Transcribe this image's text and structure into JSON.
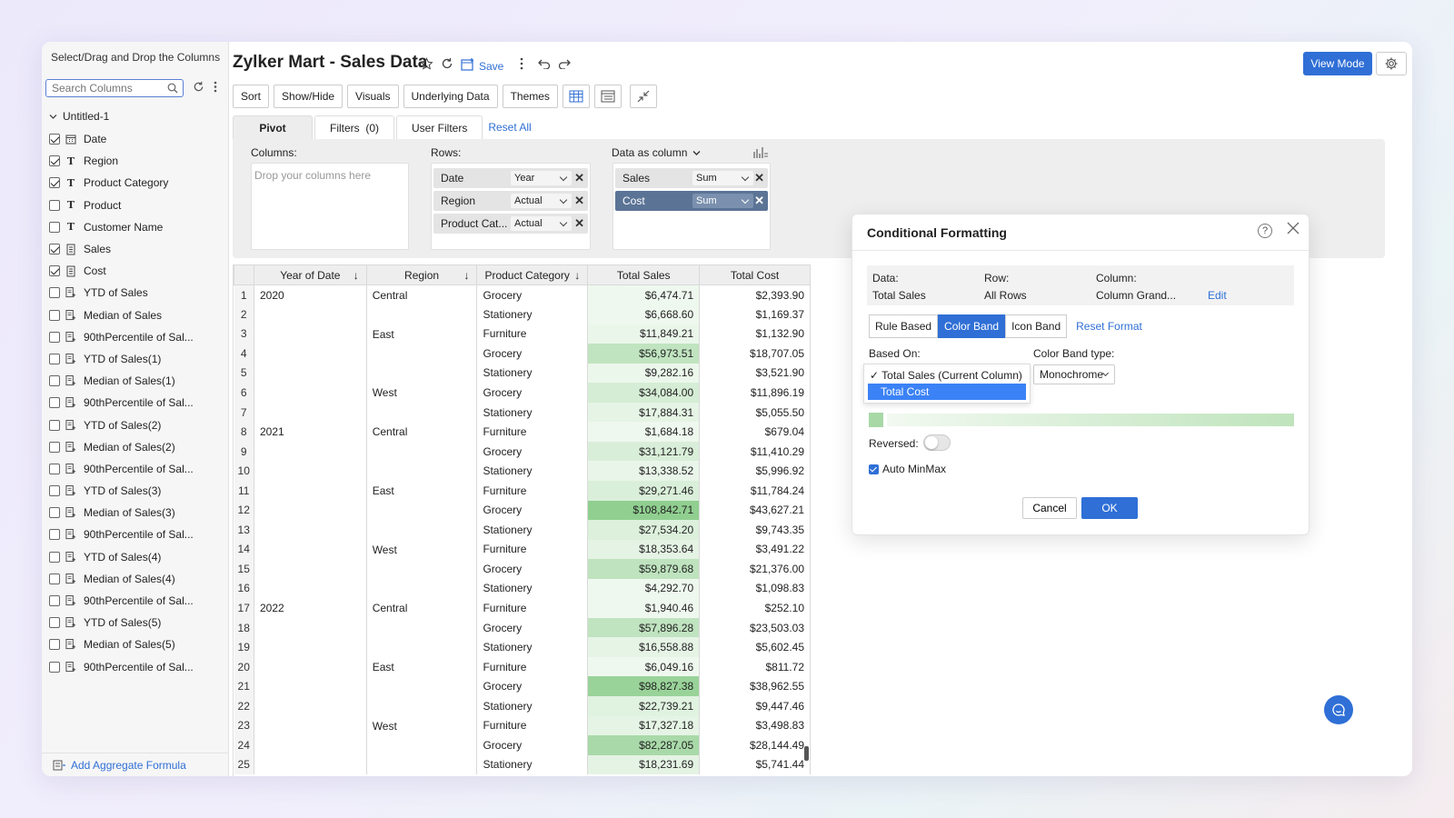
{
  "sidebar": {
    "title": "Select/Drag and Drop the Columns",
    "search_placeholder": "Search Columns",
    "root": "Untitled-1",
    "columns": [
      {
        "label": "Date",
        "checked": true,
        "icon": "calendar-icon"
      },
      {
        "label": "Region",
        "checked": true,
        "icon": "text-type-icon"
      },
      {
        "label": "Product Category",
        "checked": true,
        "icon": "text-type-icon"
      },
      {
        "label": "Product",
        "checked": false,
        "icon": "text-type-icon"
      },
      {
        "label": "Customer Name",
        "checked": false,
        "icon": "text-type-icon"
      },
      {
        "label": "Sales",
        "checked": true,
        "icon": "numeric-icon"
      },
      {
        "label": "Cost",
        "checked": true,
        "icon": "numeric-icon"
      },
      {
        "label": "YTD of Sales",
        "checked": false,
        "icon": "formula-icon"
      },
      {
        "label": "Median of Sales",
        "checked": false,
        "icon": "formula-icon"
      },
      {
        "label": "90thPercentile of Sal...",
        "checked": false,
        "icon": "formula-icon"
      },
      {
        "label": "YTD of Sales(1)",
        "checked": false,
        "icon": "formula-icon"
      },
      {
        "label": "Median of Sales(1)",
        "checked": false,
        "icon": "formula-icon"
      },
      {
        "label": "90thPercentile of Sal...",
        "checked": false,
        "icon": "formula-icon"
      },
      {
        "label": "YTD of Sales(2)",
        "checked": false,
        "icon": "formula-icon"
      },
      {
        "label": "Median of Sales(2)",
        "checked": false,
        "icon": "formula-icon"
      },
      {
        "label": "90thPercentile of Sal...",
        "checked": false,
        "icon": "formula-icon"
      },
      {
        "label": "YTD of Sales(3)",
        "checked": false,
        "icon": "formula-icon"
      },
      {
        "label": "Median of Sales(3)",
        "checked": false,
        "icon": "formula-icon"
      },
      {
        "label": "90thPercentile of Sal...",
        "checked": false,
        "icon": "formula-icon"
      },
      {
        "label": "YTD of Sales(4)",
        "checked": false,
        "icon": "formula-icon"
      },
      {
        "label": "Median of Sales(4)",
        "checked": false,
        "icon": "formula-icon"
      },
      {
        "label": "90thPercentile of Sal...",
        "checked": false,
        "icon": "formula-icon"
      },
      {
        "label": "YTD of Sales(5)",
        "checked": false,
        "icon": "formula-icon"
      },
      {
        "label": "Median of Sales(5)",
        "checked": false,
        "icon": "formula-icon"
      },
      {
        "label": "90thPercentile of Sal...",
        "checked": false,
        "icon": "formula-icon"
      }
    ],
    "footer_link": "Add Aggregate Formula"
  },
  "header": {
    "title": "Zylker Mart - Sales Data",
    "save_label": "Save",
    "view_mode": "View Mode"
  },
  "toolbar": [
    "Sort",
    "Show/Hide",
    "Visuals",
    "Underlying Data",
    "Themes"
  ],
  "tabs": {
    "pivot": "Pivot",
    "filters": "Filters  (0)",
    "user_filters": "User Filters",
    "reset": "Reset All"
  },
  "pivot": {
    "columns_label": "Columns:",
    "columns_placeholder": "Drop your columns here",
    "rows_label": "Rows:",
    "rows": [
      {
        "name": "Date",
        "agg": "Year"
      },
      {
        "name": "Region",
        "agg": "Actual"
      },
      {
        "name": "Product Cat...",
        "agg": "Actual"
      }
    ],
    "data_label": "Data as column",
    "data": [
      {
        "name": "Sales",
        "agg": "Sum",
        "selected": false
      },
      {
        "name": "Cost",
        "agg": "Sum",
        "selected": true
      }
    ]
  },
  "table": {
    "headers": [
      "Year of Date",
      "Region",
      "Product Category",
      "Total Sales",
      "Total Cost"
    ],
    "rows": [
      [
        "2020",
        "Central",
        "Grocery",
        "$6,474.71",
        "$2,393.90"
      ],
      [
        "",
        "",
        "Stationery",
        "$6,668.60",
        "$1,169.37"
      ],
      [
        "",
        "East",
        "Furniture",
        "$11,849.21",
        "$1,132.90"
      ],
      [
        "",
        "",
        "Grocery",
        "$56,973.51",
        "$18,707.05"
      ],
      [
        "",
        "",
        "Stationery",
        "$9,282.16",
        "$3,521.90"
      ],
      [
        "",
        "West",
        "Grocery",
        "$34,084.00",
        "$11,896.19"
      ],
      [
        "",
        "",
        "Stationery",
        "$17,884.31",
        "$5,055.50"
      ],
      [
        "2021",
        "Central",
        "Furniture",
        "$1,684.18",
        "$679.04"
      ],
      [
        "",
        "",
        "Grocery",
        "$31,121.79",
        "$11,410.29"
      ],
      [
        "",
        "",
        "Stationery",
        "$13,338.52",
        "$5,996.92"
      ],
      [
        "",
        "East",
        "Furniture",
        "$29,271.46",
        "$11,784.24"
      ],
      [
        "",
        "",
        "Grocery",
        "$108,842.71",
        "$43,627.21"
      ],
      [
        "",
        "",
        "Stationery",
        "$27,534.20",
        "$9,743.35"
      ],
      [
        "",
        "West",
        "Furniture",
        "$18,353.64",
        "$3,491.22"
      ],
      [
        "",
        "",
        "Grocery",
        "$59,879.68",
        "$21,376.00"
      ],
      [
        "",
        "",
        "Stationery",
        "$4,292.70",
        "$1,098.83"
      ],
      [
        "2022",
        "Central",
        "Furniture",
        "$1,940.46",
        "$252.10"
      ],
      [
        "",
        "",
        "Grocery",
        "$57,896.28",
        "$23,503.03"
      ],
      [
        "",
        "",
        "Stationery",
        "$16,558.88",
        "$5,602.45"
      ],
      [
        "",
        "East",
        "Furniture",
        "$6,049.16",
        "$811.72"
      ],
      [
        "",
        "",
        "Grocery",
        "$98,827.38",
        "$38,962.55"
      ],
      [
        "",
        "",
        "Stationery",
        "$22,739.21",
        "$9,447.46"
      ],
      [
        "",
        "West",
        "Furniture",
        "$17,327.18",
        "$3,498.83"
      ],
      [
        "",
        "",
        "Grocery",
        "$82,287.05",
        "$28,144.49"
      ],
      [
        "",
        "",
        "Stationery",
        "$18,231.69",
        "$5,741.44"
      ]
    ],
    "band_color": "#5cb85c",
    "sales_max": 108842.71
  },
  "dialog": {
    "title": "Conditional Formatting",
    "data_label": "Data:",
    "data_value": "Total Sales",
    "row_label": "Row:",
    "row_value": "All Rows",
    "column_label": "Column:",
    "column_value": "Column Grand...",
    "edit": "Edit",
    "tabs": [
      "Rule Based",
      "Color Band",
      "Icon Band"
    ],
    "reset": "Reset Format",
    "based_on_label": "Based On:",
    "based_on_options": [
      "✓ Total Sales (Current Column)",
      "Total Cost"
    ],
    "band_type_label": "Color Band type:",
    "band_type_value": "Monochrome",
    "reversed_label": "Reversed:",
    "auto_minmax": "Auto MinMax",
    "cancel": "Cancel",
    "ok": "OK"
  }
}
